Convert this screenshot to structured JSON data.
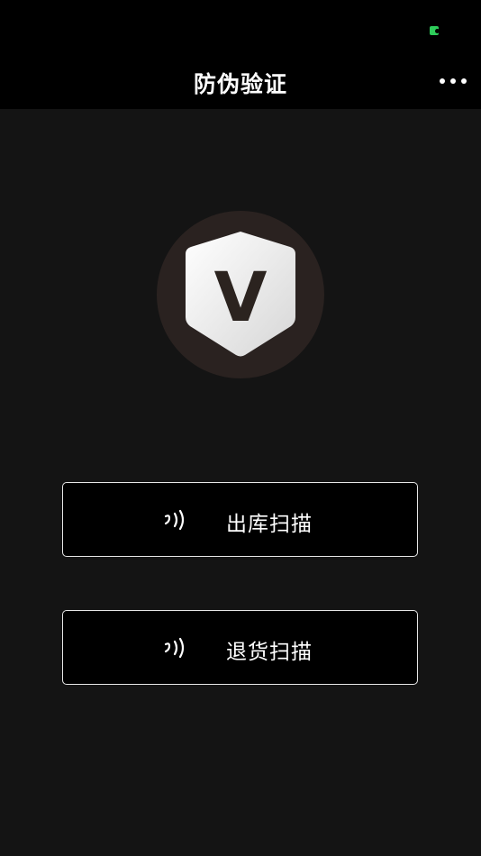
{
  "nav": {
    "title": "防伪验证",
    "more_icon": "more-dots-icon"
  },
  "status": {
    "indicator_color": "#2ecc5a"
  },
  "logo": {
    "letter": "V",
    "icon": "shield-v-icon"
  },
  "actions": [
    {
      "label": "出库扫描",
      "icon": "nfc-icon"
    },
    {
      "label": "退货扫描",
      "icon": "nfc-icon"
    }
  ],
  "colors": {
    "background": "#141414",
    "bar": "#000000",
    "button_border": "#e8e8e8",
    "logo_ring": "#2a2220",
    "shield": "#f0f0f0",
    "letter": "#2b231f"
  }
}
